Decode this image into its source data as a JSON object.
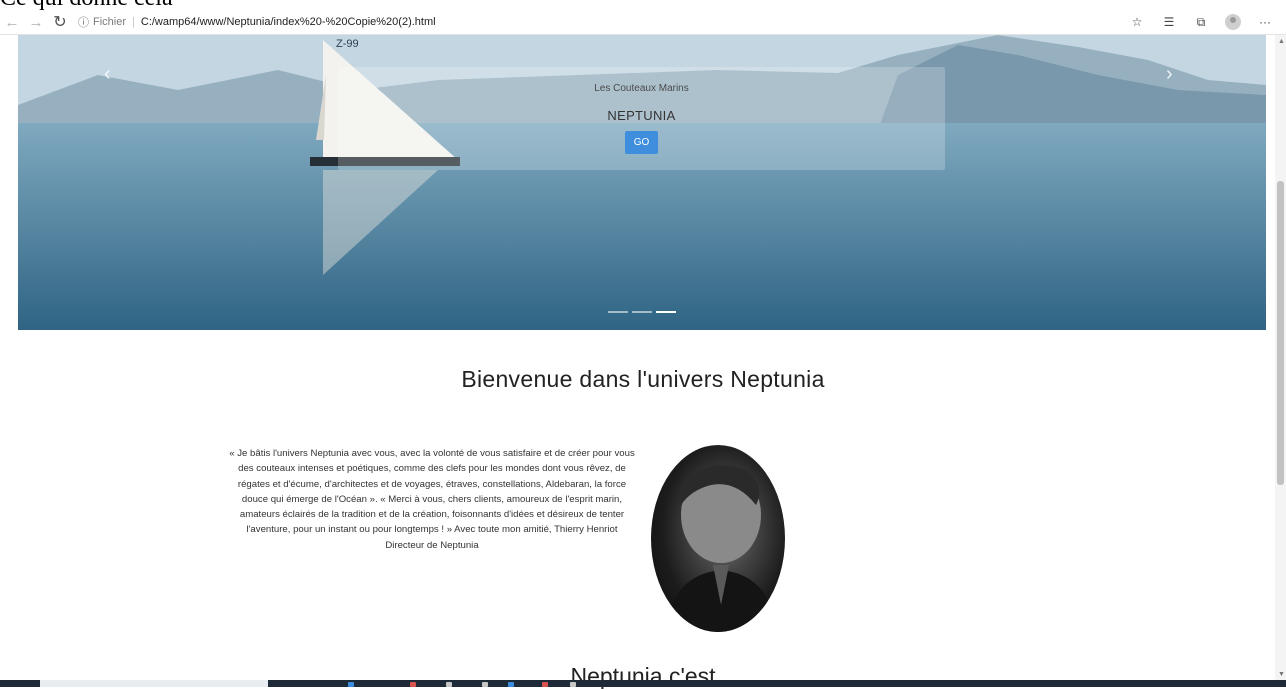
{
  "caption_text": "Ce qui donne cela",
  "browser": {
    "back_icon": "back-arrow-icon",
    "forward_icon": "forward-arrow-icon",
    "reload_icon": "reload-icon",
    "info_glyph": "ⓘ",
    "scheme": "Fichier",
    "separator": "|",
    "url": "C:/wamp64/www/Neptunia/index%20-%20Copie%20(2).html",
    "menu_label": "···"
  },
  "hero": {
    "subtitle": "Les Couteaux Marins",
    "title": "NEPTUNIA",
    "button_label": "GO",
    "prev_glyph": "‹",
    "next_glyph": "›",
    "sail_number": "Z-99",
    "indicators": 3,
    "active_indicator": 2
  },
  "main": {
    "heading": "Bienvenue dans l'univers Neptunia",
    "quote": "« Je bâtis l'univers Neptunia avec vous, avec la volonté de vous satisfaire et de créer pour vous des couteaux intenses et poétiques, comme des clefs pour les mondes dont vous rêvez, de régates et d'écume, d'architectes et de voyages, étraves, constellations, Aldebaran, la force douce qui émerge de l'Océan ». « Merci à vous, chers clients, amoureux de l'esprit marin, amateurs éclairés de la tradition et de la création, foisonnants d'idées et désireux de tenter l'aventure, pour un instant ou pour longtemps ! » Avec toute mon amitié, Thierry Henriot Directeur de Neptunia",
    "next_heading": "Neptunia c'est"
  },
  "colors": {
    "go_button": "#3f8edd",
    "taskbar": "#1f2a38"
  }
}
